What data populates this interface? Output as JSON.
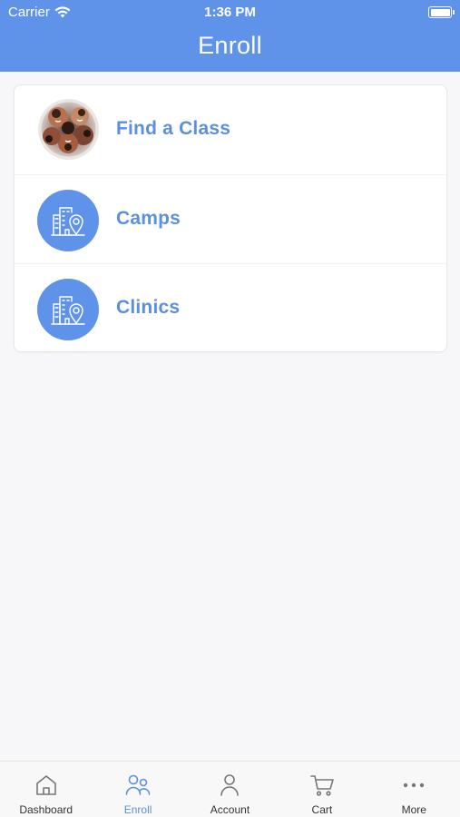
{
  "status_bar": {
    "carrier": "Carrier",
    "time": "1:36 PM",
    "battery_level": 1.0
  },
  "header": {
    "title": "Enroll",
    "background_color": "#5f93ea"
  },
  "menu": {
    "items": [
      {
        "label": "Find a Class",
        "icon": "kids-photo-avatar"
      },
      {
        "label": "Camps",
        "icon": "building-location-icon"
      },
      {
        "label": "Clinics",
        "icon": "building-location-icon"
      }
    ]
  },
  "tabbar": {
    "active": "Enroll",
    "accent_color": "#5b8fe0",
    "tabs": [
      {
        "label": "Dashboard",
        "icon": "home-icon"
      },
      {
        "label": "Enroll",
        "icon": "people-icon"
      },
      {
        "label": "Account",
        "icon": "person-icon"
      },
      {
        "label": "Cart",
        "icon": "cart-icon"
      },
      {
        "label": "More",
        "icon": "more-dots-icon"
      }
    ]
  }
}
